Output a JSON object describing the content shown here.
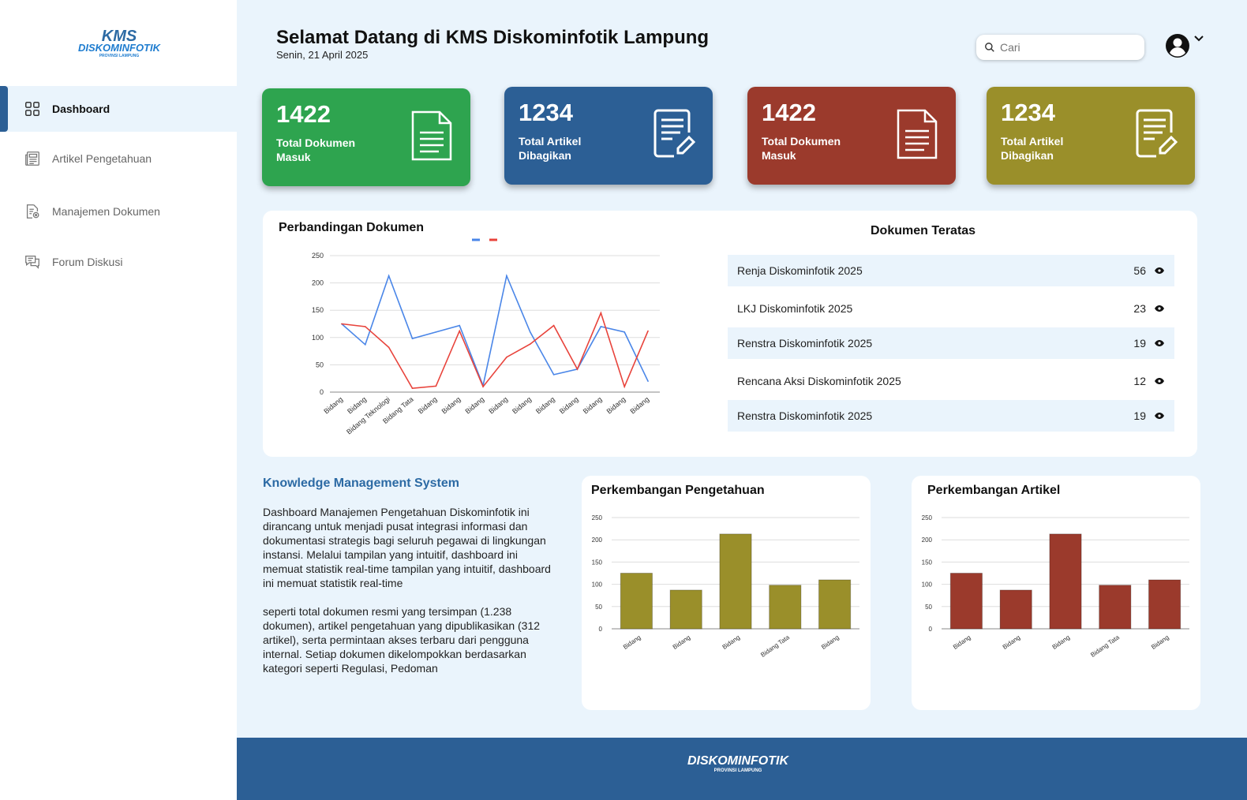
{
  "logo": {
    "main": "KMS",
    "sub": "DISKOMINFOTIK",
    "tag": "PROVINSI LAMPUNG"
  },
  "sidebar": {
    "items": [
      {
        "label": "Dashboard",
        "icon": "grid-icon"
      },
      {
        "label": "Artikel Pengetahuan",
        "icon": "newspaper-icon"
      },
      {
        "label": "Manajemen Dokumen",
        "icon": "document-gear-icon"
      },
      {
        "label": "Forum Diskusi",
        "icon": "chat-icon"
      }
    ]
  },
  "header": {
    "title": "Selamat Datang di KMS Diskominfotik Lampung",
    "date": "Senin, 21 April 2025",
    "search_placeholder": "Cari"
  },
  "cards": [
    {
      "value": "1422",
      "label": "Total Dokumen Masuk",
      "color": "#2ea44f"
    },
    {
      "value": "1234",
      "label": "Total Artikel Dibagikan",
      "color": "#2c5f95"
    },
    {
      "value": "1422",
      "label": "Total Dokumen Masuk",
      "color": "#9b3a2c"
    },
    {
      "value": "1234",
      "label": "Total Artikel Dibagikan",
      "color": "#9a8f2a"
    }
  ],
  "comparison": {
    "title": "Perbandingan Dokumen"
  },
  "top_docs": {
    "title": "Dokumen Teratas",
    "rows": [
      {
        "name": "Renja Diskominfotik 2025",
        "count": "56"
      },
      {
        "name": "LKJ Diskominfotik 2025",
        "count": "23"
      },
      {
        "name": "Renstra Diskominfotik 2025",
        "count": "19"
      },
      {
        "name": "Rencana Aksi Diskominfotik 2025",
        "count": "12"
      },
      {
        "name": "Renstra Diskominfotik 2025",
        "count": "19"
      }
    ]
  },
  "kms": {
    "title": "Knowledge Management System",
    "p1": "Dashboard Manajemen Pengetahuan Diskominfotik ini dirancang untuk menjadi pusat integrasi informasi dan dokumentasi strategis bagi seluruh pegawai di lingkungan instansi. Melalui tampilan yang intuitif, dashboard ini memuat statistik real-time tampilan yang intuitif, dashboard ini memuat statistik real-time",
    "p2": "seperti total dokumen resmi yang tersimpan (1.238 dokumen), artikel pengetahuan yang dipublikasikan (312 artikel), serta permintaan akses terbaru dari pengguna internal. Setiap dokumen dikelompokkan berdasarkan kategori seperti Regulasi, Pedoman"
  },
  "footer": {
    "logo": "DISKOMINFOTIK",
    "tag": "PROVINSI LAMPUNG"
  },
  "chart_data": [
    {
      "type": "line",
      "title": "Perbandingan Dokumen",
      "categories": [
        "Bidang",
        "Bidang",
        "Bidang Teknologi",
        "Bidang Tata",
        "Bidang",
        "Bidang",
        "Bidang",
        "Bidang",
        "Bidang",
        "Bidang",
        "Bidang",
        "Bidang",
        "Bidang",
        "Bidang"
      ],
      "ylim": [
        0,
        250
      ],
      "yticks": [
        0,
        50,
        100,
        150,
        200,
        250
      ],
      "grid": true,
      "series": [
        {
          "color": "#4a86e8",
          "values": [
            125,
            87,
            213,
            98,
            110,
            122,
            12,
            213,
            110,
            32,
            42,
            120,
            110,
            20
          ]
        },
        {
          "color": "#e8433b",
          "values": [
            125,
            120,
            82,
            7,
            11,
            112,
            10,
            64,
            88,
            122,
            42,
            145,
            10,
            112
          ]
        }
      ]
    },
    {
      "type": "bar",
      "title": "Perkembangan Pengetahuan",
      "categories": [
        "Bidang",
        "Bidang",
        "Bidang",
        "Bidang Tata",
        "Bidang"
      ],
      "values": [
        125,
        87,
        213,
        98,
        110
      ],
      "ylim": [
        0,
        250
      ],
      "yticks": [
        0,
        50,
        100,
        150,
        200,
        250
      ],
      "color": "#9a8f2a"
    },
    {
      "type": "bar",
      "title": "Perkembangan Artikel",
      "categories": [
        "Bidang",
        "Bidang",
        "Bidang",
        "Bidang Tata",
        "Bidang"
      ],
      "values": [
        125,
        87,
        213,
        98,
        110
      ],
      "ylim": [
        0,
        250
      ],
      "yticks": [
        0,
        50,
        100,
        150,
        200,
        250
      ],
      "color": "#9b3a2c"
    }
  ]
}
